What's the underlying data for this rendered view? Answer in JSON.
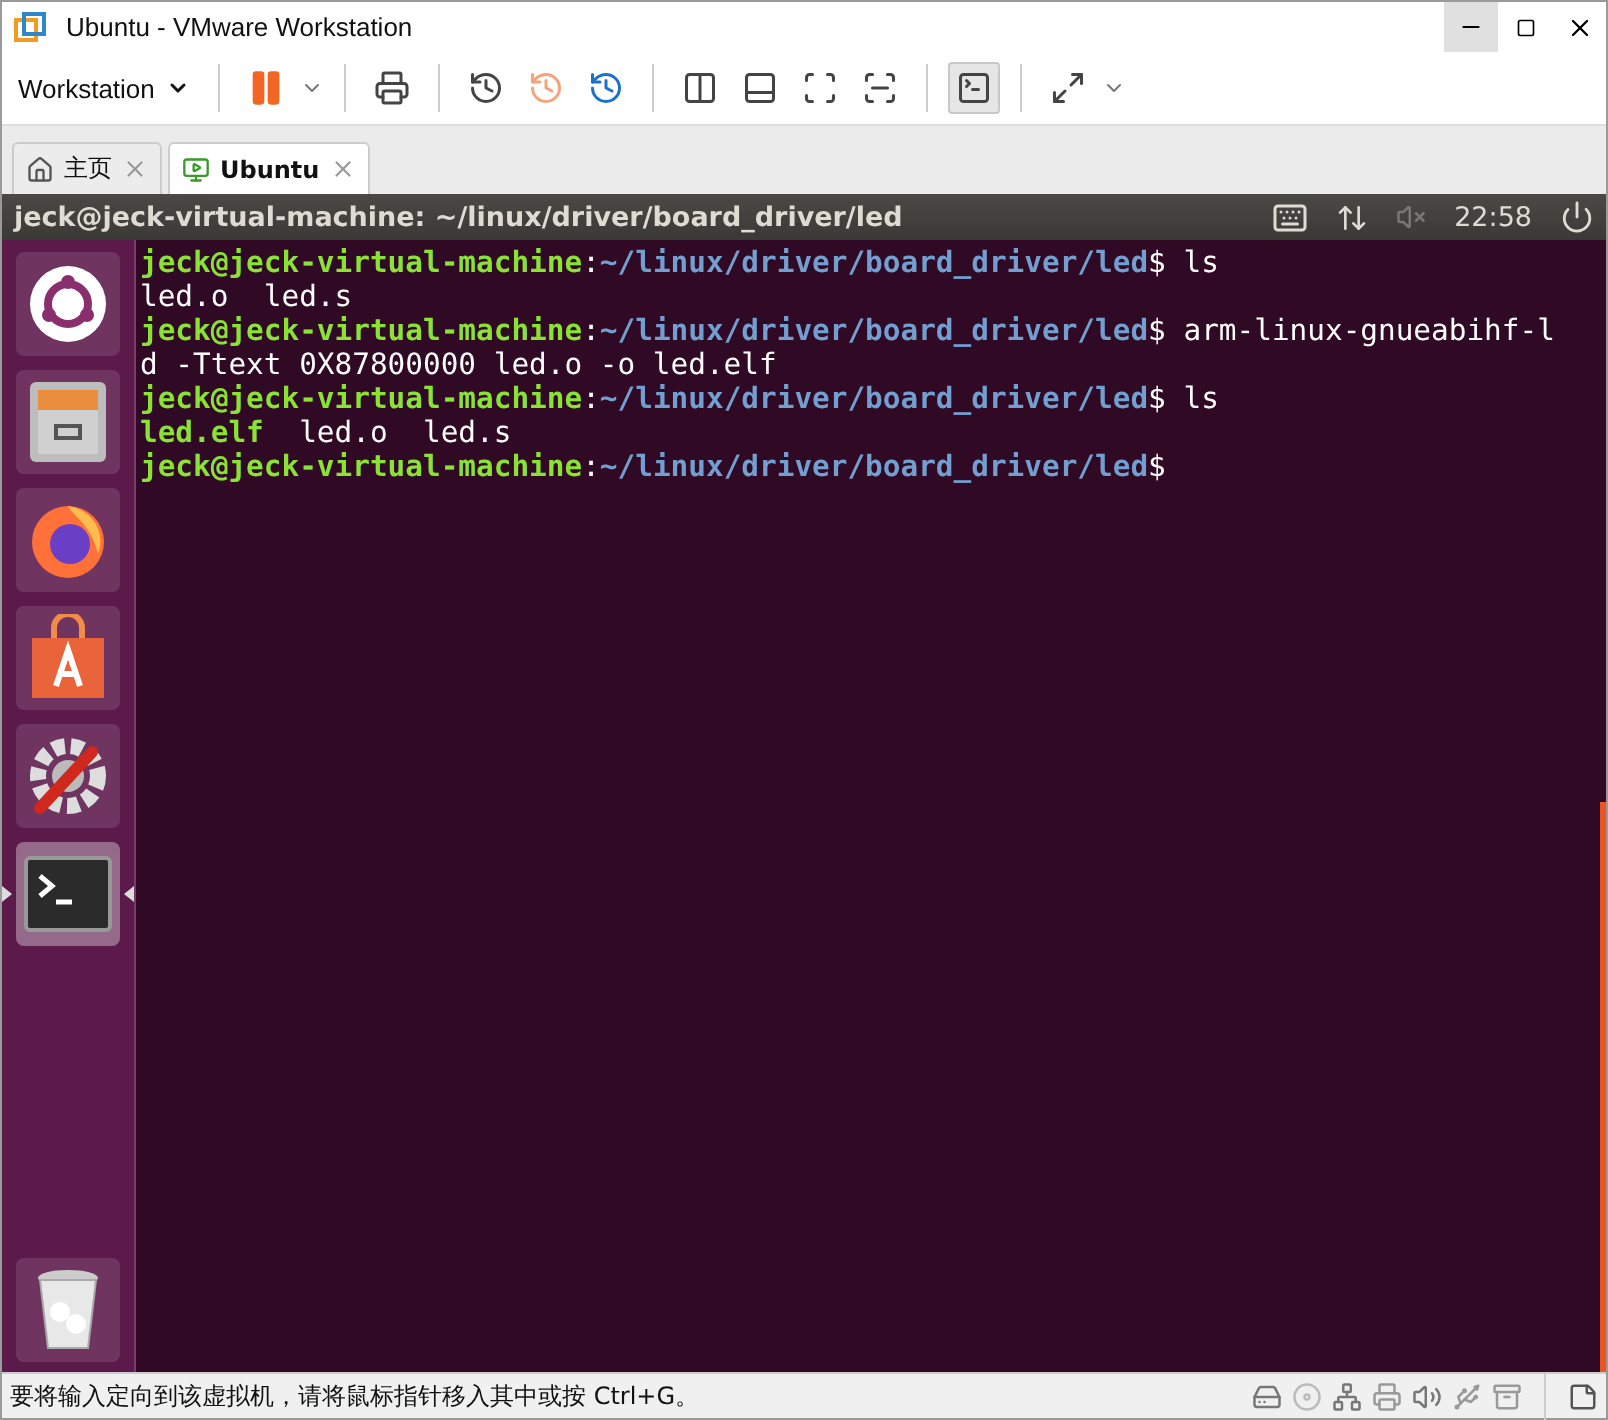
{
  "window": {
    "title": "Ubuntu - VMware Workstation"
  },
  "toolbar": {
    "menu": "Workstation"
  },
  "tabs": [
    {
      "label": "主页",
      "kind": "home",
      "selected": false
    },
    {
      "label": "Ubuntu",
      "kind": "vm",
      "selected": true
    }
  ],
  "vm_topbar": {
    "title": "jeck@jeck-virtual-machine: ~/linux/driver/board_driver/led",
    "time": "22:58"
  },
  "launcher": [
    {
      "kind": "ubuntu",
      "selected": false
    },
    {
      "kind": "files",
      "selected": false
    },
    {
      "kind": "browser",
      "selected": false
    },
    {
      "kind": "store",
      "selected": false
    },
    {
      "kind": "settings",
      "selected": false
    },
    {
      "kind": "terminal",
      "selected": true
    }
  ],
  "terminal": [
    {
      "kind": "prompt",
      "user": "jeck@jeck-virtual-machine",
      "sep": ":",
      "path": "~/linux/driver/board_driver/led",
      "command": "$ ls"
    },
    {
      "kind": "output",
      "segments": [
        {
          "text": "led.o  led.s",
          "exec": false
        }
      ]
    },
    {
      "kind": "prompt",
      "user": "jeck@jeck-virtual-machine",
      "sep": ":",
      "path": "~/linux/driver/board_driver/led",
      "command": "$ arm-linux-gnueabihf-l"
    },
    {
      "kind": "output",
      "segments": [
        {
          "text": "d -Ttext 0X87800000 led.o -o led.elf",
          "exec": false
        }
      ]
    },
    {
      "kind": "prompt",
      "user": "jeck@jeck-virtual-machine",
      "sep": ":",
      "path": "~/linux/driver/board_driver/led",
      "command": "$ ls"
    },
    {
      "kind": "output",
      "segments": [
        {
          "text": "led.elf",
          "exec": true
        },
        {
          "text": "  led.o  led.s",
          "exec": false
        }
      ]
    },
    {
      "kind": "prompt",
      "user": "jeck@jeck-virtual-machine",
      "sep": ":",
      "path": "~/linux/driver/board_driver/led",
      "command": "$"
    }
  ],
  "status_bar": {
    "message": "要将输入定向到该虚拟机，请将鼠标指针移入其中或按 Ctrl+G。"
  }
}
